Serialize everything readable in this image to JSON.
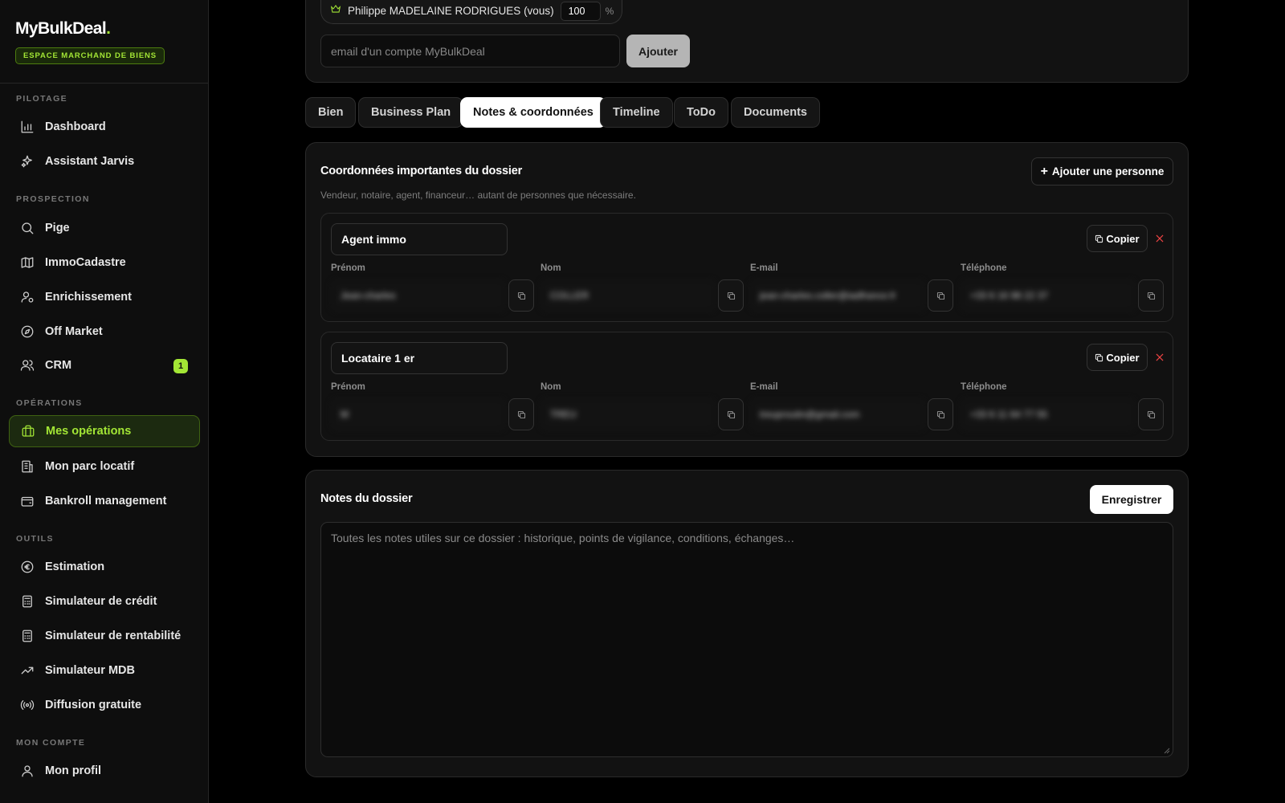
{
  "brand": {
    "logo_prefix": "My",
    "logo_bold": "BulkDeal",
    "logo_dot": ".",
    "badge": "ESPACE MARCHAND DE BIENS"
  },
  "sidebar": {
    "sections": {
      "pilotage": "PILOTAGE",
      "prospection": "PROSPECTION",
      "operations": "OPÉRATIONS",
      "outils": "OUTILS",
      "compte": "MON COMPTE"
    },
    "items": [
      {
        "label": "Dashboard",
        "icon": "bar-chart-icon"
      },
      {
        "label": "Assistant Jarvis",
        "icon": "sparkles-icon"
      },
      {
        "label": "Pige",
        "icon": "search-icon"
      },
      {
        "label": "ImmoCadastre",
        "icon": "map-icon"
      },
      {
        "label": "Enrichissement",
        "icon": "user-cog-icon"
      },
      {
        "label": "Off Market",
        "icon": "compass-icon"
      },
      {
        "label": "CRM",
        "icon": "users-icon",
        "badge": "1"
      },
      {
        "label": "Mes opérations",
        "icon": "briefcase-icon",
        "active": true
      },
      {
        "label": "Mon parc locatif",
        "icon": "building-icon"
      },
      {
        "label": "Bankroll management",
        "icon": "wallet-icon"
      },
      {
        "label": "Estimation",
        "icon": "euro-icon"
      },
      {
        "label": "Simulateur de crédit",
        "icon": "calculator-icon"
      },
      {
        "label": "Simulateur de rentabilité",
        "icon": "calculator-icon"
      },
      {
        "label": "Simulateur MDB",
        "icon": "trending-up-icon"
      },
      {
        "label": "Diffusion gratuite",
        "icon": "broadcast-icon"
      },
      {
        "label": "Mon profil",
        "icon": "user-icon"
      }
    ]
  },
  "owners": {
    "owner_name": "Philippe MADELAINE RODRIGUES (vous)",
    "owner_pct": "100",
    "pct_sign": "%",
    "email_placeholder": "email d'un compte MyBulkDeal",
    "add_label": "Ajouter"
  },
  "tabs": [
    {
      "label": "Bien"
    },
    {
      "label": "Business Plan"
    },
    {
      "label": "Notes & coordonnées",
      "active": true
    },
    {
      "label": "Timeline"
    },
    {
      "label": "ToDo"
    },
    {
      "label": "Documents"
    }
  ],
  "contacts": {
    "title": "Coordonnées importantes du dossier",
    "subtitle": "Vendeur, notaire, agent, financeur… autant de personnes que nécessaire.",
    "add_person_label": "Ajouter une personne",
    "copy_label": "Copier",
    "field_labels": {
      "first": "Prénom",
      "last": "Nom",
      "email": "E-mail",
      "phone": "Téléphone"
    },
    "people": [
      {
        "role": "Agent immo",
        "first": "Jean-charles",
        "last": "COLLER",
        "email": "jean-charles.coller@iadfrance.fr",
        "phone": "+33 6 16 98 22 37"
      },
      {
        "role": "Locataire 1 er",
        "first": "M",
        "last": "TREU",
        "email": "treuproutin@gmail.com",
        "phone": "+33 6 11 64 77 55"
      }
    ]
  },
  "notes": {
    "title": "Notes du dossier",
    "save_label": "Enregistrer",
    "placeholder": "Toutes les notes utiles sur ce dossier : historique, points de vigilance, conditions, échanges…"
  }
}
